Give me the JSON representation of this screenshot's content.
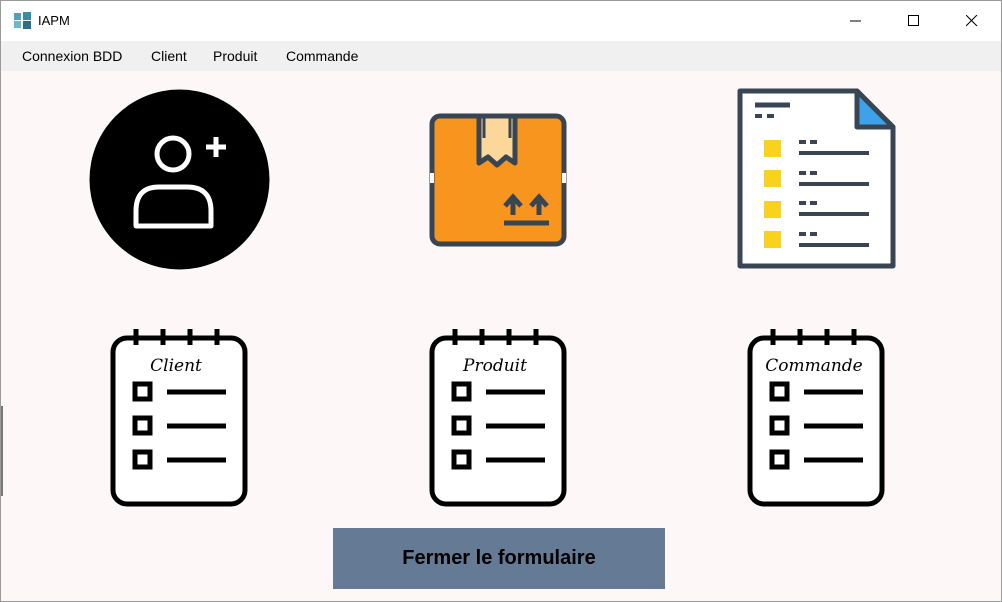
{
  "window": {
    "title": "IAPM",
    "icons": {
      "app": "app-windows-icon",
      "minimize": "minimize-icon",
      "maximize": "maximize-icon",
      "close": "close-icon"
    }
  },
  "menu": {
    "items": [
      "Connexion BDD",
      "Client",
      "Produit",
      "Commande"
    ]
  },
  "tiles": {
    "add_client": {
      "icon": "add-user-icon"
    },
    "product": {
      "icon": "package-box-icon"
    },
    "order": {
      "icon": "order-list-document-icon"
    }
  },
  "notebooks": [
    {
      "label": "Client",
      "icon": "notebook-list-icon"
    },
    {
      "label": "Produit",
      "icon": "notebook-list-icon"
    },
    {
      "label": "Commande",
      "icon": "notebook-list-icon"
    }
  ],
  "buttons": {
    "close_form": "Fermer le formulaire"
  },
  "colors": {
    "button_bg": "#647a95",
    "box_orange": "#f7951e",
    "doc_yellow": "#f9d21c",
    "doc_blue": "#3ea2ea"
  }
}
